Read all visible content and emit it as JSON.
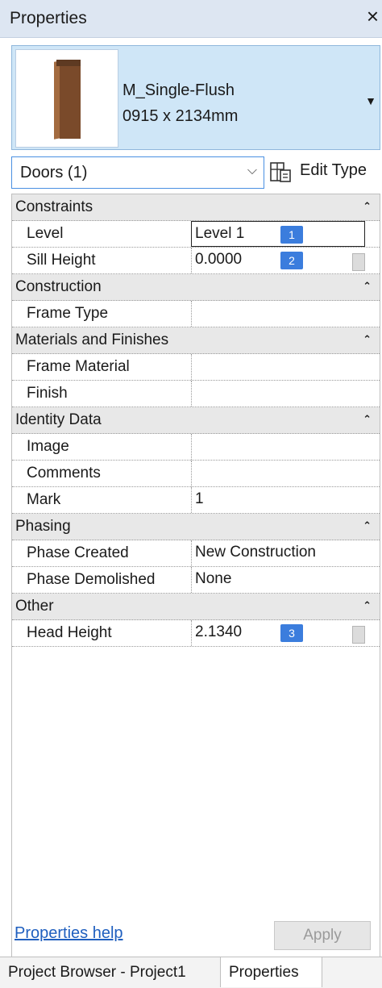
{
  "window": {
    "title": "Properties",
    "close_glyph": "×"
  },
  "type_selector": {
    "family": "M_Single-Flush",
    "size": "0915 x 2134mm",
    "dropdown_glyph": "▼",
    "thumbnail_icon": "door-icon"
  },
  "instance_filter": {
    "label": "Doors (1)",
    "chevron": "⌵"
  },
  "edit_type": {
    "label": "Edit Type",
    "icon": "edit-type-icon"
  },
  "groups": {
    "constraints": {
      "name": "Constraints",
      "collapse": "⌃"
    },
    "construction": {
      "name": "Construction",
      "collapse": "⌃"
    },
    "materials": {
      "name": "Materials and Finishes",
      "collapse": "⌃"
    },
    "identity": {
      "name": "Identity Data",
      "collapse": "⌃"
    },
    "phasing": {
      "name": "Phasing",
      "collapse": "⌃"
    },
    "other": {
      "name": "Other",
      "collapse": "⌃"
    }
  },
  "params": {
    "level": {
      "name": "Level",
      "value": "Level 1",
      "badge": "1"
    },
    "sill_height": {
      "name": "Sill Height",
      "value": "0.0000",
      "badge": "2"
    },
    "frame_type": {
      "name": "Frame Type",
      "value": ""
    },
    "frame_material": {
      "name": "Frame Material",
      "value": ""
    },
    "finish": {
      "name": "Finish",
      "value": ""
    },
    "image": {
      "name": "Image",
      "value": ""
    },
    "comments": {
      "name": "Comments",
      "value": ""
    },
    "mark": {
      "name": "Mark",
      "value": "1"
    },
    "phase_created": {
      "name": "Phase Created",
      "value": "New Construction"
    },
    "phase_demolished": {
      "name": "Phase Demolished",
      "value": "None"
    },
    "head_height": {
      "name": "Head Height",
      "value": "2.1340",
      "badge": "3"
    }
  },
  "footer": {
    "help_link": "Properties help",
    "apply": "Apply"
  },
  "tabs": [
    "Project Browser - Project1",
    "Properties"
  ],
  "colors": {
    "accent": "#3b7ddd",
    "selector_bg": "#cfe6f7",
    "group_bg": "#e8e8e8"
  }
}
